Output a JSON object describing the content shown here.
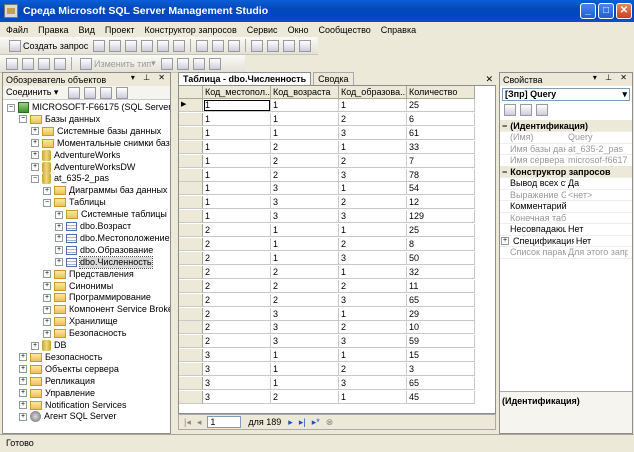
{
  "window": {
    "title": "Среда Microsoft SQL Server Management Studio",
    "min": "_",
    "max": "□",
    "close": "✕"
  },
  "menu": [
    "Файл",
    "Правка",
    "Вид",
    "Проект",
    "Конструктор запросов",
    "Сервис",
    "Окно",
    "Сообщество",
    "Справка"
  ],
  "toolbar": {
    "new_query": "Создать запрос",
    "change_type": "Изменить тип"
  },
  "explorer": {
    "title": "Обозреватель объектов",
    "connect": "Соединить",
    "items": [
      {
        "label": "MICROSOFT-F66175 (SQL Server 9.0.1399",
        "icon": "server-icon",
        "lvl": 0,
        "pm": "−"
      },
      {
        "label": "Базы данных",
        "icon": "folder-icon",
        "lvl": 1,
        "pm": "−"
      },
      {
        "label": "Системные базы данных",
        "icon": "folder-icon",
        "lvl": 2,
        "pm": "+"
      },
      {
        "label": "Моментальные снимки базы да",
        "icon": "folder-icon",
        "lvl": 2,
        "pm": "+"
      },
      {
        "label": "AdventureWorks",
        "icon": "database-icon",
        "lvl": 2,
        "pm": "+"
      },
      {
        "label": "AdventureWorksDW",
        "icon": "database-icon",
        "lvl": 2,
        "pm": "+"
      },
      {
        "label": "at_635-2_pas",
        "icon": "database-icon",
        "lvl": 2,
        "pm": "−"
      },
      {
        "label": "Диаграммы баз данных",
        "icon": "folder-icon",
        "lvl": 3,
        "pm": "+"
      },
      {
        "label": "Таблицы",
        "icon": "folder-icon",
        "lvl": 3,
        "pm": "−"
      },
      {
        "label": "Системные таблицы",
        "icon": "folder-icon",
        "lvl": 4,
        "pm": "+"
      },
      {
        "label": "dbo.Возраст",
        "icon": "table-icon",
        "lvl": 4,
        "pm": "+"
      },
      {
        "label": "dbo.Местоположение",
        "icon": "table-icon",
        "lvl": 4,
        "pm": "+"
      },
      {
        "label": "dbo.Образование",
        "icon": "table-icon",
        "lvl": 4,
        "pm": "+"
      },
      {
        "label": "dbo.Численность",
        "icon": "table-icon",
        "lvl": 4,
        "pm": "+"
      },
      {
        "label": "Представления",
        "icon": "folder-icon",
        "lvl": 3,
        "pm": "+"
      },
      {
        "label": "Синонимы",
        "icon": "folder-icon",
        "lvl": 3,
        "pm": "+"
      },
      {
        "label": "Программирование",
        "icon": "folder-icon",
        "lvl": 3,
        "pm": "+"
      },
      {
        "label": "Компонент Service Broker",
        "icon": "folder-icon",
        "lvl": 3,
        "pm": "+"
      },
      {
        "label": "Хранилище",
        "icon": "folder-icon",
        "lvl": 3,
        "pm": "+"
      },
      {
        "label": "Безопасность",
        "icon": "folder-icon",
        "lvl": 3,
        "pm": "+"
      },
      {
        "label": "DB",
        "icon": "database-icon",
        "lvl": 2,
        "pm": "+"
      },
      {
        "label": "Безопасность",
        "icon": "folder-icon",
        "lvl": 1,
        "pm": "+"
      },
      {
        "label": "Объекты сервера",
        "icon": "folder-icon",
        "lvl": 1,
        "pm": "+"
      },
      {
        "label": "Репликация",
        "icon": "folder-icon",
        "lvl": 1,
        "pm": "+"
      },
      {
        "label": "Управление",
        "icon": "folder-icon",
        "lvl": 1,
        "pm": "+"
      },
      {
        "label": "Notification Services",
        "icon": "folder-icon",
        "lvl": 1,
        "pm": "+"
      },
      {
        "label": "Агент SQL Server",
        "icon": "agent-icon",
        "lvl": 1,
        "pm": "+"
      }
    ]
  },
  "tabs": {
    "active": "Таблица - dbo.Численность",
    "other": "Сводка",
    "close": "✕"
  },
  "grid": {
    "columns": [
      "Код_местопол...",
      "Код_возраста",
      "Код_образова...",
      "Количество"
    ],
    "rows": [
      [
        "1",
        "1",
        "1",
        "25"
      ],
      [
        "1",
        "1",
        "2",
        "6"
      ],
      [
        "1",
        "1",
        "3",
        "61"
      ],
      [
        "1",
        "2",
        "1",
        "33"
      ],
      [
        "1",
        "2",
        "2",
        "7"
      ],
      [
        "1",
        "2",
        "3",
        "78"
      ],
      [
        "1",
        "3",
        "1",
        "54"
      ],
      [
        "1",
        "3",
        "2",
        "12"
      ],
      [
        "1",
        "3",
        "3",
        "129"
      ],
      [
        "2",
        "1",
        "1",
        "25"
      ],
      [
        "2",
        "1",
        "2",
        "8"
      ],
      [
        "2",
        "1",
        "3",
        "50"
      ],
      [
        "2",
        "2",
        "1",
        "32"
      ],
      [
        "2",
        "2",
        "2",
        "11"
      ],
      [
        "2",
        "2",
        "3",
        "65"
      ],
      [
        "2",
        "3",
        "1",
        "29"
      ],
      [
        "2",
        "3",
        "2",
        "10"
      ],
      [
        "2",
        "3",
        "3",
        "59"
      ],
      [
        "3",
        "1",
        "1",
        "15"
      ],
      [
        "3",
        "1",
        "2",
        "3"
      ],
      [
        "3",
        "1",
        "3",
        "65"
      ],
      [
        "3",
        "2",
        "1",
        "45"
      ]
    ]
  },
  "nav": {
    "current": "1",
    "of_total": "для 189"
  },
  "properties": {
    "title": "Свойства",
    "selector": "[Зпр] Query",
    "rows": [
      {
        "type": "cat",
        "name": "(Идентификация)"
      },
      {
        "name": "(Имя)",
        "value": "Query",
        "gray": true
      },
      {
        "name": "Имя базы данн",
        "value": "at_635-2_pas",
        "gray": true
      },
      {
        "name": "Имя сервера",
        "value": "microsof-f66175",
        "gray": true
      },
      {
        "type": "cat",
        "name": "Конструктор запросов"
      },
      {
        "name": "Вывод всех сто",
        "value": "Да"
      },
      {
        "name": "Выражение GR",
        "value": "<нет>",
        "gray": true
      },
      {
        "name": "Комментарий S",
        "value": ""
      },
      {
        "name": "Конечная табл",
        "value": "",
        "gray": true
      },
      {
        "name": "Несовпадающ",
        "value": "Нет"
      },
      {
        "name": "Спецификация",
        "value": "Нет",
        "pm": true
      },
      {
        "name": "Список параме",
        "value": "Для этого запроса",
        "gray": true
      }
    ],
    "footer": "(Идентификация)"
  },
  "status": "Готово"
}
